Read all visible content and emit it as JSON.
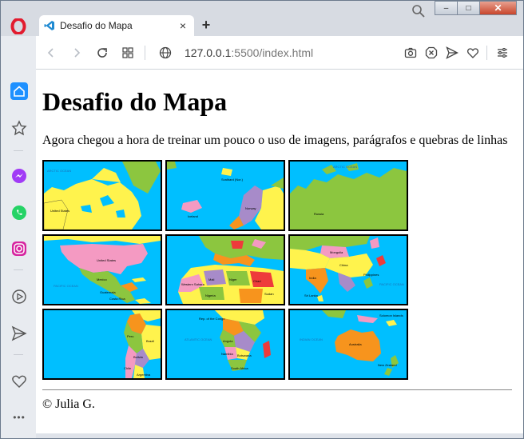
{
  "browser": {
    "tab_title": "Desafio do Mapa",
    "tab_close": "×",
    "new_tab": "+",
    "url_host": "127.0.0.1",
    "url_path": ":5500/index.html",
    "icons": [
      "opera-logo-icon",
      "vscode-icon",
      "back-icon",
      "forward-icon",
      "reload-icon",
      "tab-grid-icon",
      "globe-icon",
      "camera-icon",
      "adblock-icon",
      "send-icon",
      "heart-icon",
      "settings-icon",
      "search-icon"
    ],
    "window_controls": {
      "minimize": "–",
      "maximize": "□",
      "close": "✕"
    }
  },
  "sidebar": {
    "items": [
      "home-icon",
      "bookmarks-icon",
      "messenger-icon",
      "whatsapp-icon",
      "instagram-icon",
      "player-icon",
      "send-icon",
      "heart-icon",
      "more-icon"
    ],
    "more_label": "•••"
  },
  "page": {
    "title": "Desafio do Mapa",
    "intro": "Agora chegou a hora de treinar um pouco o uso de imagens, parágrafos e quebras de linhas",
    "footer": "© Julia G."
  },
  "map": {
    "tiles": [
      {
        "labels": [
          "ARCTIC OCEAN",
          "United States"
        ]
      },
      {
        "labels": [
          "Svalbard (Nor.)",
          "Iceland",
          "Norway"
        ]
      },
      {
        "labels": [
          "ARCTIC OCEAN",
          "Russia"
        ]
      },
      {
        "labels": [
          "United States",
          "PACIFIC OCEAN",
          "Mexico",
          "Guatemala",
          "Costa Rica"
        ]
      },
      {
        "labels": [
          "Western Sahara",
          "Mali",
          "Niger",
          "Chad",
          "Sudan",
          "Nigeria"
        ]
      },
      {
        "labels": [
          "Mongolia",
          "China",
          "India",
          "Philippines",
          "PACIFIC OCEAN",
          "Sri Lanka"
        ]
      },
      {
        "labels": [
          "Peru",
          "Brazil",
          "Bolivia",
          "Chile",
          "Argentina"
        ]
      },
      {
        "labels": [
          "Rep. of the Congo",
          "Angola",
          "Namibia",
          "Botswana",
          "ATLANTIC OCEAN",
          "South Africa"
        ]
      },
      {
        "labels": [
          "INDIAN OCEAN",
          "Australia",
          "Solomon Islands",
          "New Zealand"
        ]
      }
    ],
    "colors": {
      "ocean": "#00bfff",
      "yellow": "#fff34d",
      "green": "#8cc63f",
      "orange": "#f7941d",
      "pink": "#f49ac2",
      "purple": "#a78bc9",
      "red": "#ee3b3b"
    }
  }
}
